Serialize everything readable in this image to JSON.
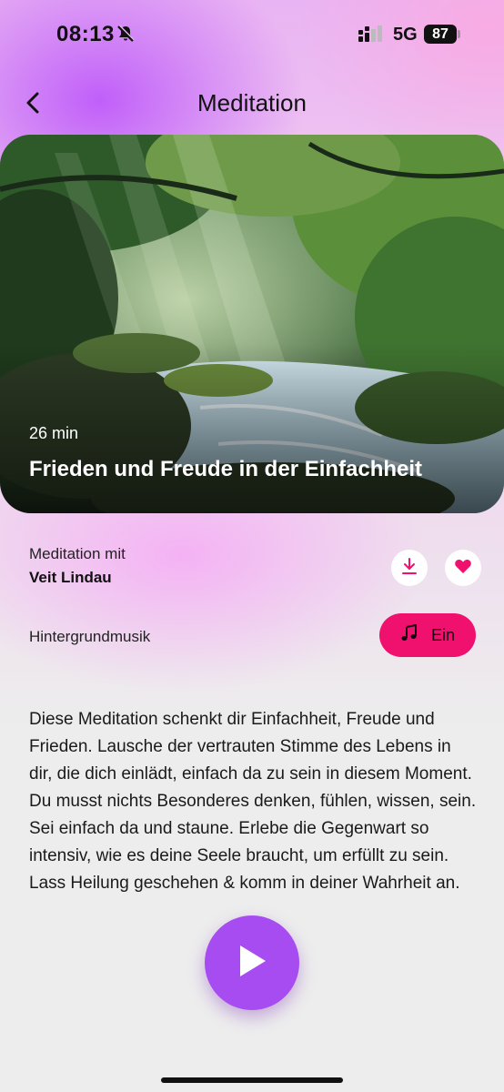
{
  "status_bar": {
    "time": "08:13",
    "network": "5G",
    "battery": "87",
    "icons": [
      "bell-slash-icon",
      "signal-icon"
    ]
  },
  "nav": {
    "back_icon": "chevron-left-icon",
    "title": "Meditation"
  },
  "hero": {
    "image": "forest-river-sunbeams",
    "duration": "26 min",
    "title": "Frieden und Freude in der Einfachheit"
  },
  "teacher": {
    "label": "Meditation mit",
    "name": "Veit Lindau"
  },
  "actions": {
    "download_icon": "download-icon",
    "favorite_icon": "heart-icon",
    "accent_color": "#f0106e"
  },
  "background_music": {
    "label": "Hintergrundmusik",
    "toggle_icon": "music-note-icon",
    "toggle_label": "Ein"
  },
  "description": "Diese Meditation schenkt dir Einfachheit, Freude und Frieden. Lausche der vertrauten Stimme des Lebens in dir, die dich einlädt, einfach da zu sein in diesem Moment. Du musst nichts Besonderes denken, fühlen, wissen, sein. Sei einfach da und staune. Erlebe die Gegenwart so intensiv, wie es deine Seele braucht, um erfüllt zu sein. Lass Heilung geschehen & komm in deiner Wahrheit an.",
  "player": {
    "play_icon": "play-icon",
    "button_color": "#a74cf0"
  }
}
